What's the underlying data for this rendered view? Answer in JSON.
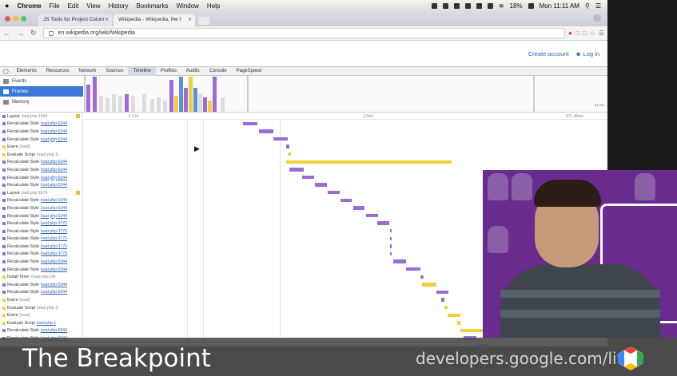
{
  "menubar": {
    "app": "Chrome",
    "items": [
      "File",
      "Edit",
      "View",
      "History",
      "Bookmarks",
      "Window",
      "Help"
    ],
    "battery": "18%",
    "clock": "Mon 11:11 AM"
  },
  "tabs": [
    {
      "title": "JS Tools for Project Colum",
      "active": false
    },
    {
      "title": "Wikipedia - Wikipedia, the f",
      "active": true
    }
  ],
  "address_bar": {
    "url": "en.wikipedia.org/wiki/Wikipedia"
  },
  "page": {
    "create_account": "Create account",
    "login": "Log in"
  },
  "devtools": {
    "tabs": [
      "Elements",
      "Resources",
      "Network",
      "Sources",
      "Timeline",
      "Profiles",
      "Audits",
      "Console",
      "PageSpeed"
    ],
    "active_tab": "Timeline",
    "overview_modes": [
      "Events",
      "Frames",
      "Memory"
    ],
    "selected_mode": "Frames",
    "overview_scale": "41 ms",
    "ruler": [
      "1.17s",
      "1.56s",
      "571.40ms"
    ],
    "records": [
      {
        "name": "Layout",
        "src": "load.php:1064",
        "color": "#9b6bd6",
        "warn": true,
        "plain": true
      },
      {
        "name": "Recalculate Style",
        "src": "load.php:5344",
        "color": "#9b6bd6"
      },
      {
        "name": "Recalculate Style",
        "src": "load.php:5344",
        "color": "#9b6bd6"
      },
      {
        "name": "Recalculate Style",
        "src": "load.php:5344",
        "color": "#9b6bd6"
      },
      {
        "name": "Event",
        "src": "(load)",
        "color": "#f0d040",
        "plain": true
      },
      {
        "name": "Evaluate Script",
        "src": "(load.php:1)",
        "color": "#f0d040",
        "plain": true
      },
      {
        "name": "Recalculate Style",
        "src": "load.php:5344",
        "color": "#9b6bd6"
      },
      {
        "name": "Recalculate Style",
        "src": "load.php:5344",
        "color": "#9b6bd6"
      },
      {
        "name": "Recalculate Style",
        "src": "load.php:5344",
        "color": "#9b6bd6"
      },
      {
        "name": "Recalculate Style",
        "src": "load.php:5344",
        "color": "#9b6bd6"
      },
      {
        "name": "Layout",
        "src": "load.php:1876",
        "color": "#9b6bd6",
        "warn": true,
        "plain": true
      },
      {
        "name": "Recalculate Style",
        "src": "load.php:5344",
        "color": "#9b6bd6"
      },
      {
        "name": "Recalculate Style",
        "src": "load.php:5344",
        "color": "#9b6bd6"
      },
      {
        "name": "Recalculate Style",
        "src": "load.php:5344",
        "color": "#9b6bd6"
      },
      {
        "name": "Recalculate Style",
        "src": "load.php:3770",
        "color": "#9b6bd6"
      },
      {
        "name": "Recalculate Style",
        "src": "load.php:3770",
        "color": "#9b6bd6"
      },
      {
        "name": "Recalculate Style",
        "src": "load.php:3770",
        "color": "#9b6bd6"
      },
      {
        "name": "Recalculate Style",
        "src": "load.php:3770",
        "color": "#9b6bd6"
      },
      {
        "name": "Recalculate Style",
        "src": "load.php:3770",
        "color": "#9b6bd6"
      },
      {
        "name": "Recalculate Style",
        "src": "load.php:5344",
        "color": "#9b6bd6"
      },
      {
        "name": "Recalculate Style",
        "src": "load.php:5344",
        "color": "#9b6bd6"
      },
      {
        "name": "Install Timer",
        "src": "(load.php:14)",
        "color": "#f0d040",
        "plain": true
      },
      {
        "name": "Recalculate Style",
        "src": "load.php:5344",
        "color": "#9b6bd6"
      },
      {
        "name": "Recalculate Style",
        "src": "load.php:5344",
        "color": "#9b6bd6"
      },
      {
        "name": "Event",
        "src": "(load)",
        "color": "#f0d040",
        "plain": true
      },
      {
        "name": "Evaluate Script",
        "src": "(load.php:1)",
        "color": "#f0d040",
        "plain": true
      },
      {
        "name": "Event",
        "src": "(load)",
        "color": "#f0d040",
        "plain": true
      },
      {
        "name": "Evaluate Script",
        "src": "load.php:1",
        "color": "#f0d040"
      },
      {
        "name": "Recalculate Style",
        "src": "load.php:5344",
        "color": "#9b6bd6"
      },
      {
        "name": "Recalculate Style",
        "src": "load.php:5344",
        "color": "#9b6bd6"
      }
    ]
  },
  "lower_third": {
    "title": "The Breakpoint",
    "url": "developers.google.com/live"
  },
  "colors": {
    "rendering": "#9b6bd6",
    "scripting": "#f0d040",
    "loading": "#5b8fe0",
    "presenter_bg": "#6a2b8e"
  }
}
